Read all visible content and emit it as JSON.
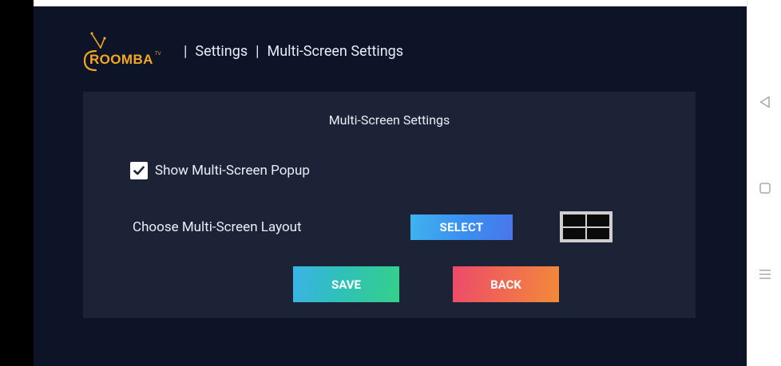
{
  "header": {
    "logo_text": "ROOMBA",
    "logo_superscript": "TV",
    "breadcrumb": {
      "sep1": "|",
      "item1": "Settings",
      "sep2": "|",
      "item2": "Multi-Screen Settings"
    }
  },
  "panel": {
    "title": "Multi-Screen Settings",
    "show_popup": {
      "label": "Show Multi-Screen Popup",
      "checked": true
    },
    "layout": {
      "label": "Choose Multi-Screen Layout",
      "select_label": "SELECT",
      "preview_icon": "grid-2x2-icon"
    },
    "save_label": "SAVE",
    "back_label": "BACK"
  },
  "nav": {
    "back_icon": "triangle-back-icon",
    "home_icon": "square-home-icon",
    "menu_icon": "menu-lines-icon"
  },
  "colors": {
    "background": "#0d1428",
    "panel": "#1c2336",
    "logo_accent": "#f5a623",
    "select_start": "#40b3ee",
    "select_end": "#4a76ea",
    "save_start": "#3bb3e8",
    "save_end": "#35d08a",
    "back_start": "#ec4a6a",
    "back_end": "#f38a3a"
  }
}
